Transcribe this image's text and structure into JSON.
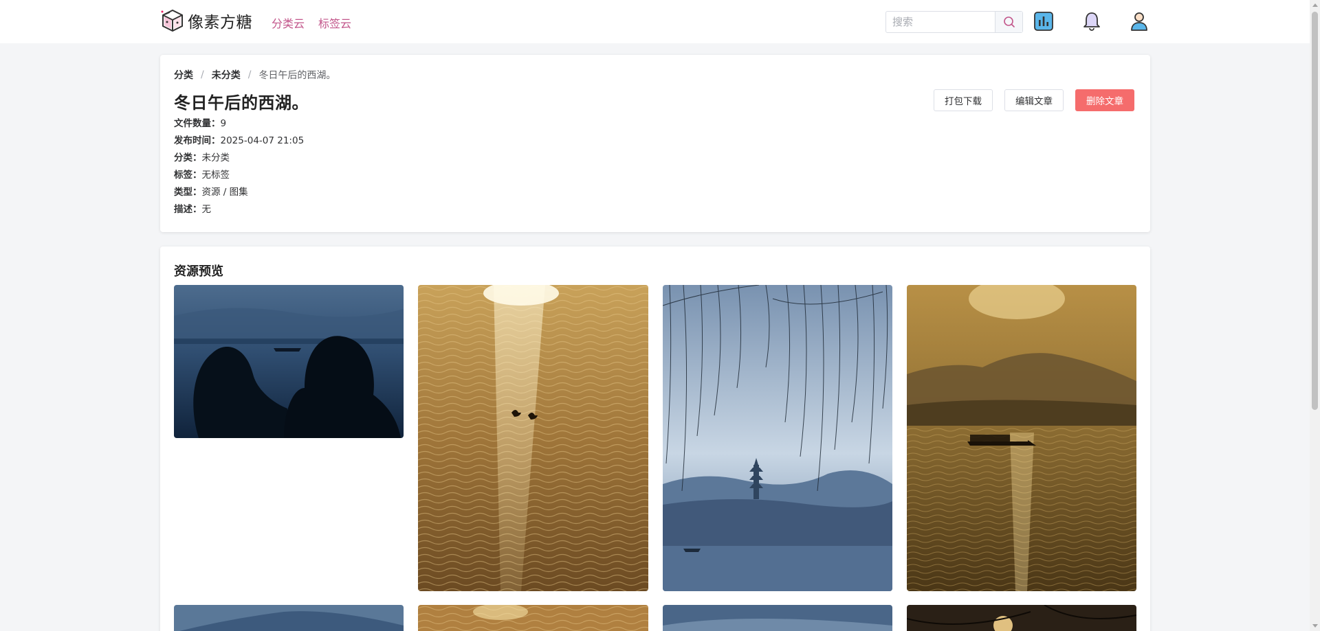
{
  "header": {
    "logo_text": "像素方糖",
    "nav": [
      "分类云",
      "标签云"
    ],
    "search_placeholder": "搜索",
    "icons": [
      "search-icon",
      "stats-icon",
      "bell-icon",
      "user-icon"
    ]
  },
  "breadcrumb": [
    "分类",
    "未分类",
    "冬日午后的西湖。"
  ],
  "article": {
    "title": "冬日午后的西湖。",
    "meta": [
      {
        "label": "文件数量：",
        "value": "9"
      },
      {
        "label": "发布时间：",
        "value": "2025-04-07 21:05"
      },
      {
        "label": "分类：",
        "value": "未分类"
      },
      {
        "label": "标签：",
        "value": "无标签"
      },
      {
        "label": "类型：",
        "value": "资源 / 图集"
      },
      {
        "label": "描述：",
        "value": "无"
      }
    ]
  },
  "actions": {
    "download": "打包下载",
    "edit": "编辑文章",
    "delete": "删除文章"
  },
  "preview": {
    "title": "资源预览"
  },
  "colors": {
    "accent": "#c2558a",
    "danger": "#f56c6c",
    "background": "#f4f5f7"
  }
}
